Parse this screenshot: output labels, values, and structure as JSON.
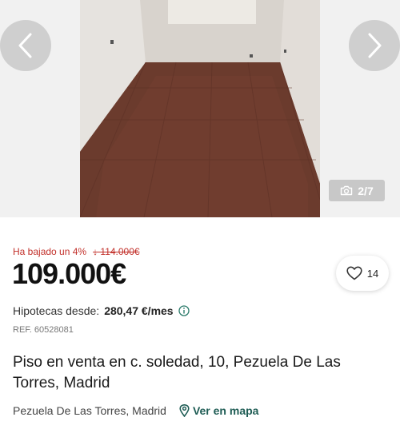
{
  "gallery": {
    "prev_icon": "chevron-left-icon",
    "next_icon": "chevron-right-icon",
    "counter": "2/7",
    "counter_icon": "camera-icon"
  },
  "listing": {
    "price_drop_label": "Ha bajado un 4%",
    "old_price": "↓ 114.000€",
    "price": "109.000€",
    "favorites_count": "14",
    "mortgage_label": "Hipotecas desde:",
    "mortgage_value": "280,47 €/mes",
    "reference": "REF. 60528081",
    "title": "Piso en venta en c. soledad, 10, Pezuela De Las Torres, Madrid",
    "location": "Pezuela De Las Torres, Madrid",
    "map_link": "Ver en mapa"
  },
  "colors": {
    "price_drop": "#c2302a",
    "map_link": "#1e5c54"
  }
}
